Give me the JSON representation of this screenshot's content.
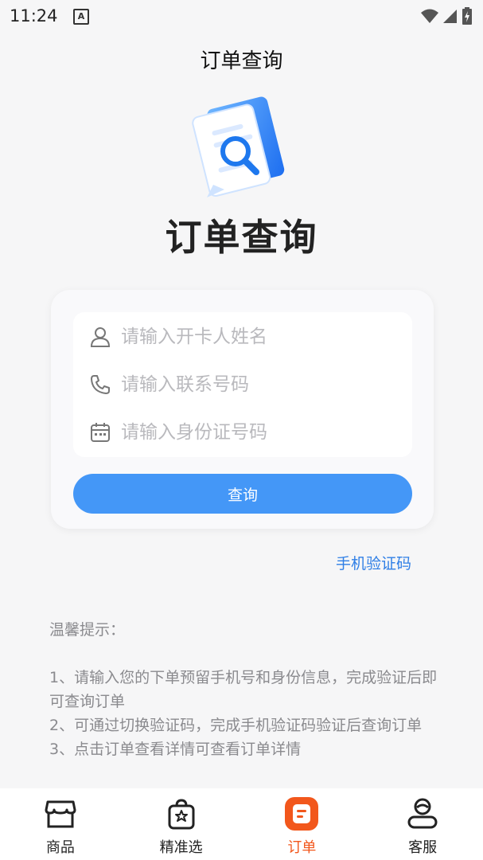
{
  "status_bar": {
    "time": "11:24",
    "a_icon": "A"
  },
  "header": {
    "title": "订单查询"
  },
  "hero": {
    "title": "订单查询",
    "icon": "document-search-icon"
  },
  "form": {
    "name_placeholder": "请输入开卡人姓名",
    "phone_placeholder": "请输入联系号码",
    "id_placeholder": "请输入身份证号码",
    "query_label": "查询"
  },
  "sms_link": "手机验证码",
  "tips": {
    "title": "温馨提示：",
    "items": [
      "1、请输入您的下单预留手机号和身份信息，完成验证后即可查询订单",
      "2、可通过切换验证码，完成手机验证码验证后查询订单",
      "3、点击订单查看详情可查看订单详情"
    ]
  },
  "tabs": [
    {
      "label": "商品",
      "icon": "store-icon",
      "active": false
    },
    {
      "label": "精准选",
      "icon": "shopping-bag-star-icon",
      "active": false
    },
    {
      "label": "订单",
      "icon": "order-icon",
      "active": true
    },
    {
      "label": "客服",
      "icon": "customer-service-icon",
      "active": false
    }
  ],
  "colors": {
    "primary": "#4497f7",
    "accent": "#f2571c",
    "link": "#2f7fe6"
  }
}
